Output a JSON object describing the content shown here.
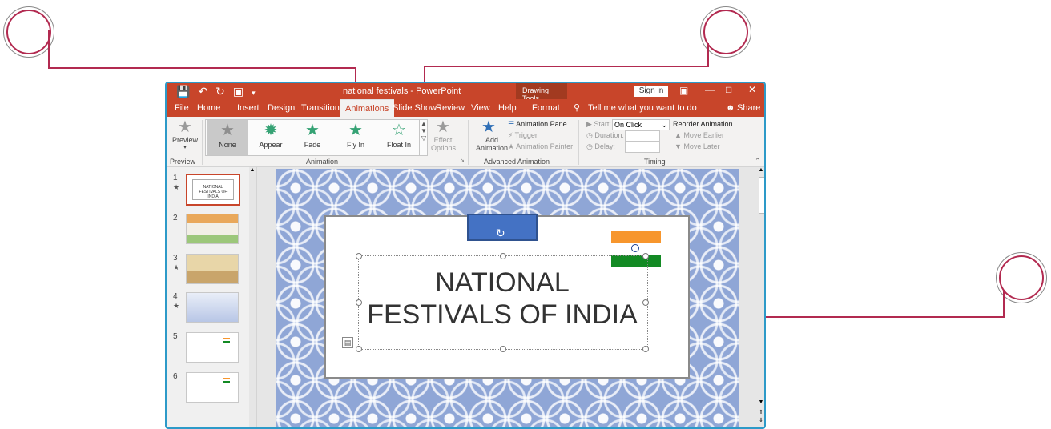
{
  "window": {
    "title": "national festivals - PowerPoint",
    "contextual_tab_group": "Drawing Tools",
    "sign_in": "Sign in"
  },
  "tabs": [
    "File",
    "Home",
    "Insert",
    "Design",
    "Transitions",
    "Animations",
    "Slide Show",
    "Review",
    "View",
    "Help",
    "Format"
  ],
  "active_tab": "Animations",
  "tell_me": "Tell me what you want to do",
  "share": "Share",
  "ribbon": {
    "preview_label": "Preview",
    "preview_group": "Preview",
    "animation_group": "Animation",
    "advanced_group": "Advanced Animation",
    "timing_group": "Timing",
    "gallery": [
      "None",
      "Appear",
      "Fade",
      "Fly In",
      "Float In"
    ],
    "effect_options": "Effect Options",
    "add_animation": "Add Animation",
    "animation_pane": "Animation Pane",
    "trigger": "Trigger",
    "animation_painter": "Animation Painter",
    "start_label": "Start:",
    "start_value": "On Click",
    "duration_label": "Duration:",
    "delay_label": "Delay:",
    "reorder": "Reorder Animation",
    "move_earlier": "Move Earlier",
    "move_later": "Move Later"
  },
  "thumbnails": [
    {
      "num": "1",
      "star": true,
      "text": "NATIONAL FESTIVALS OF INDIA"
    },
    {
      "num": "2",
      "star": false,
      "text": ""
    },
    {
      "num": "3",
      "star": true,
      "text": ""
    },
    {
      "num": "4",
      "star": true,
      "text": ""
    },
    {
      "num": "5",
      "star": false,
      "text": ""
    },
    {
      "num": "6",
      "star": false,
      "text": ""
    }
  ],
  "slide": {
    "title_line1": "NATIONAL",
    "title_line2": "FESTIVALS OF INDIA"
  },
  "colors": {
    "accent": "#c8452a",
    "callout": "#b22a50",
    "flag_saffron": "#f7962d",
    "flag_green": "#138a24",
    "shape_blue": "#4472c4"
  }
}
